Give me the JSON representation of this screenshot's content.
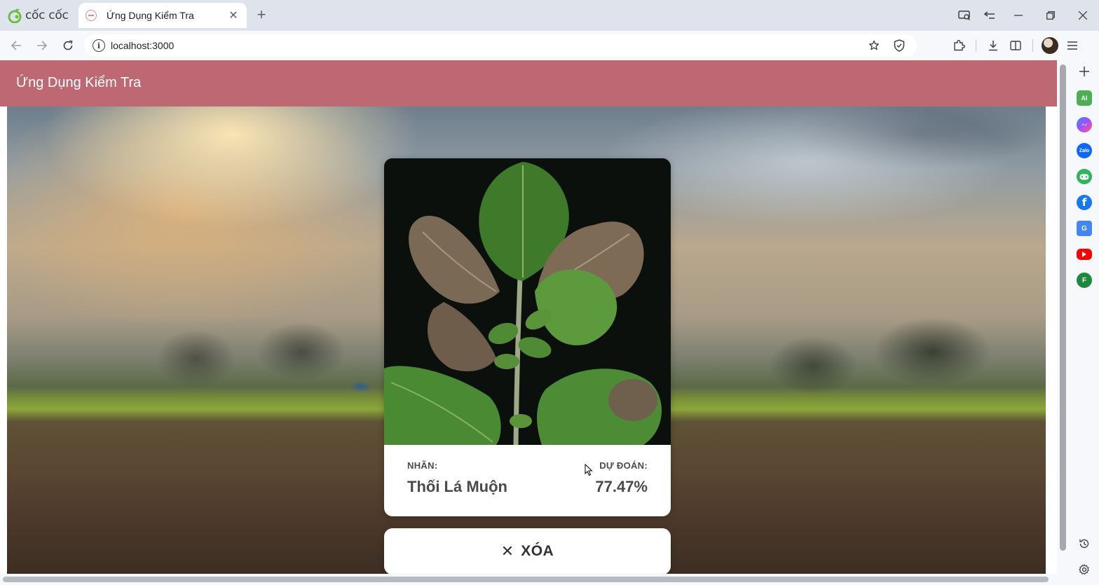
{
  "browser": {
    "brand_name": "cốc cốc",
    "tab_title": "Ứng Dụng Kiểm Tra",
    "url": "localhost:3000",
    "new_tab_glyph": "+",
    "close_glyph": "✕"
  },
  "page": {
    "header_title": "Ứng Dụng Kiểm Tra",
    "result": {
      "label_heading": "NHÃN:",
      "label_value": "Thối Lá Muộn",
      "prediction_heading": "DỰ ĐOÁN:",
      "prediction_value": "77.47%"
    },
    "clear_button": {
      "icon": "✕",
      "label": "XÓA"
    }
  },
  "sidebar_icons": [
    "plus-icon",
    "ai-icon",
    "messenger-icon",
    "zalo-icon",
    "game-icon",
    "facebook-icon",
    "translate-icon",
    "youtube-icon",
    "f-icon",
    "history-icon",
    "settings-icon"
  ],
  "colors": {
    "header": "#be6874",
    "browser_frame": "#dfe3eb",
    "card": "#ffffff",
    "text_dark": "#4a4a4a"
  }
}
